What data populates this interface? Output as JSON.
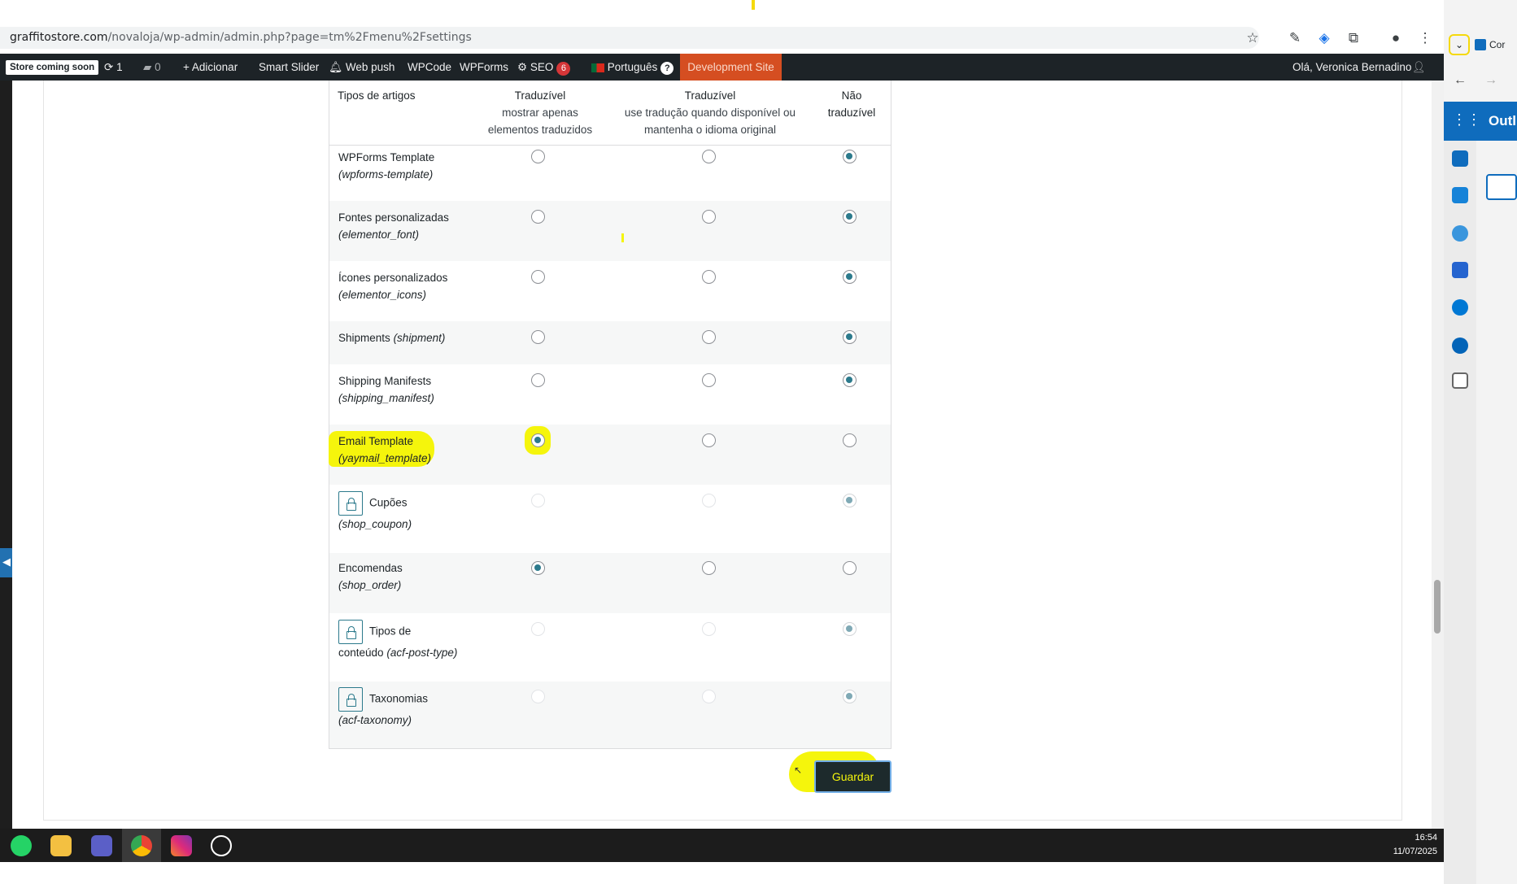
{
  "browser": {
    "url_host": "graffitostore.com",
    "url_path": "/novaloja/wp-admin/admin.php?page=tm%2Fmenu%2Fsettings"
  },
  "adminbar": {
    "store_badge": "Store coming soon",
    "updates_count": "1",
    "comments_count": "0",
    "add_new": "Adicionar",
    "smart_slider": "Smart Slider",
    "web_push": "Web push",
    "wpcode": "WPCode",
    "wpforms": "WPForms",
    "seo": "SEO",
    "seo_count": "6",
    "language": "Português",
    "language_badge": "?",
    "dev_site": "Development Site",
    "greeting": "Olá, Veronica Bernadino"
  },
  "table": {
    "headers": {
      "post_types": "Tipos de artigos",
      "translatable_only_title": "Traduzível",
      "translatable_only_desc1": "mostrar apenas",
      "translatable_only_desc2": "elementos traduzidos",
      "translatable_fallback_title": "Traduzível",
      "translatable_fallback_desc1": "use tradução quando disponível ou",
      "translatable_fallback_desc2": "mantenha o idioma original",
      "not_translatable_1": "Não",
      "not_translatable_2": "traduzível"
    },
    "rows": [
      {
        "name": "WPForms Template",
        "slug": "(wpforms-template)",
        "selected": 3
      },
      {
        "name": "Fontes personalizadas",
        "slug": "(elementor_font)",
        "selected": 3
      },
      {
        "name": "Ícones personalizados",
        "slug": "(elementor_icons)",
        "selected": 3
      },
      {
        "name": "Shipments",
        "slug": "(shipment)",
        "selected": 3
      },
      {
        "name": "Shipping Manifests",
        "slug": "(shipping_manifest)",
        "selected": 3
      },
      {
        "name": "Email Template",
        "slug": "(yaymail_template)",
        "selected": 1
      },
      {
        "name": "Cupões",
        "slug": "(shop_coupon)",
        "selected": 3,
        "locked": true
      },
      {
        "name": "Encomendas",
        "slug": "(shop_order)",
        "selected": 1
      },
      {
        "name": "Tipos de",
        "name2": "conteúdo",
        "slug": "(acf-post-type)",
        "selected": 3,
        "locked": true
      },
      {
        "name": "Taxonomias",
        "slug": "(acf-taxonomy)",
        "selected": 3,
        "locked": true
      }
    ]
  },
  "save_label": "Guardar",
  "taskbar": {
    "time": "16:54",
    "date": "11/07/2025"
  },
  "outlook": {
    "tab_title": "Cor",
    "app_title": "Outl"
  },
  "colors": {
    "highlight": "#f5f50c",
    "admin_bar": "#1d2327",
    "dev_site": "#d54e21",
    "radio_checked": "#2c7a8c"
  }
}
